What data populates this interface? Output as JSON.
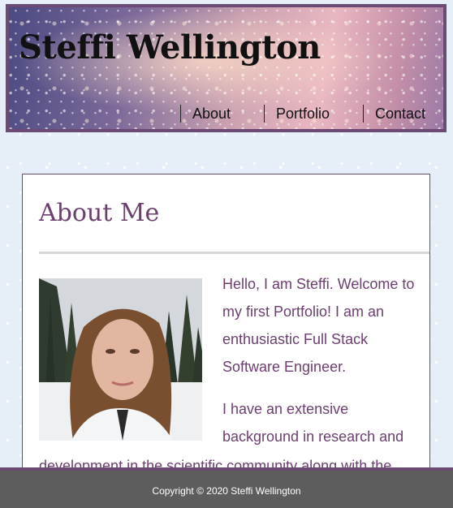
{
  "header": {
    "title": "Steffi Wellington",
    "nav": [
      {
        "label": "About"
      },
      {
        "label": "Portfolio"
      },
      {
        "label": "Contact"
      }
    ]
  },
  "about": {
    "heading": "About Me",
    "paragraphs": [
      "Hello, I am Steffi. Welcome to my first Portfolio! I am an enthusiastic Full Stack Software Engineer.",
      "I have an extensive background in research and",
      "development in the scientific community along with the"
    ]
  },
  "footer": {
    "copyright": "Copyright © 2020 Steffi Wellington"
  },
  "colors": {
    "accent": "#6b4a73",
    "text_purple": "#6b3f6f",
    "footer_bg": "#5d5d5d",
    "page_bg": "#e6eef8"
  }
}
